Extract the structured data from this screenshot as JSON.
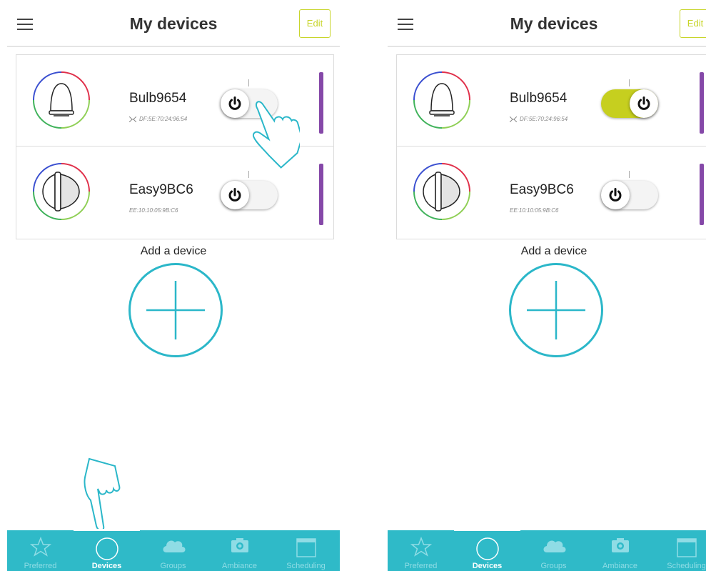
{
  "screens": [
    {
      "header": {
        "title": "My devices",
        "edit_label": "Edit"
      },
      "devices": [
        {
          "name": "Bulb9654",
          "mac": "DF:5E:70:24:96:54",
          "power": "off"
        },
        {
          "name": "Easy9BC6",
          "mac": "EE:10:10:05:9B:C6",
          "power": "off"
        }
      ],
      "add_label": "Add a device",
      "nav": [
        {
          "label": "Preferred",
          "icon": "star-icon"
        },
        {
          "label": "Devices",
          "icon": "circle-icon",
          "active": true
        },
        {
          "label": "Groups",
          "icon": "cloud-icon"
        },
        {
          "label": "Ambiance",
          "icon": "camera-icon"
        },
        {
          "label": "Scheduling",
          "icon": "calendar-icon"
        }
      ]
    },
    {
      "header": {
        "title": "My devices",
        "edit_label": "Edit"
      },
      "devices": [
        {
          "name": "Bulb9654",
          "mac": "DF:5E:70:24:96:54",
          "power": "on"
        },
        {
          "name": "Easy9BC6",
          "mac": "EE:10:10:05:9B:C6",
          "power": "off"
        }
      ],
      "add_label": "Add a device",
      "nav": [
        {
          "label": "Preferred",
          "icon": "star-icon"
        },
        {
          "label": "Devices",
          "icon": "circle-icon",
          "active": true
        },
        {
          "label": "Groups",
          "icon": "cloud-icon"
        },
        {
          "label": "Ambiance",
          "icon": "camera-icon"
        },
        {
          "label": "Scheduling",
          "icon": "calendar-icon"
        }
      ]
    }
  ],
  "colors": {
    "accent": "#c6cf1f",
    "teal": "#2fbac8",
    "purple": "#8548a8"
  }
}
